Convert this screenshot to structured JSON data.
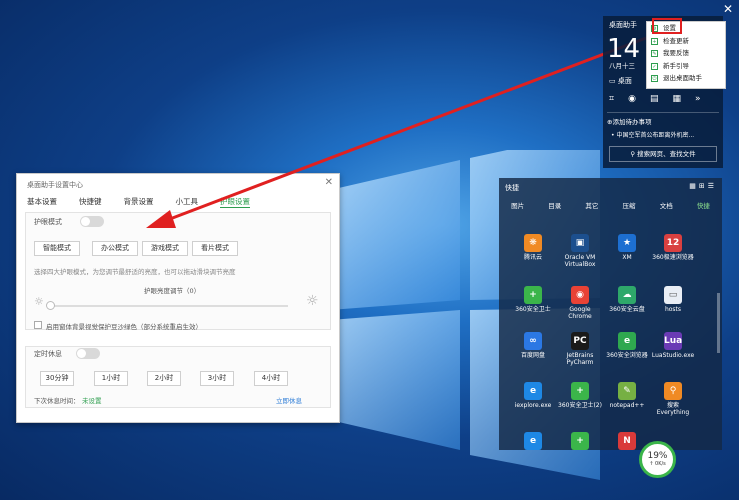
{
  "desktop": {
    "close_symbol": "✕"
  },
  "dialog": {
    "title": "桌面助手设置中心",
    "close_symbol": "✕",
    "tabs": [
      {
        "label": "基本设置"
      },
      {
        "label": "快捷键"
      },
      {
        "label": "背景设置"
      },
      {
        "label": "小工具"
      },
      {
        "label": "护眼设置"
      }
    ],
    "eye_mode_label": "护眼模式",
    "modes": [
      {
        "label": "智能模式"
      },
      {
        "label": "办公模式"
      },
      {
        "label": "游戏模式"
      },
      {
        "label": "看片模式"
      }
    ],
    "mode_hint": "选择四大护眼模式，为您调节最舒适的亮度，也可以拖动滑块调节亮度",
    "brightness_label": "护眼亮度调节（0）",
    "brightness_value": 0,
    "checkbox_label": "启用窗体背景视觉保护豆沙绿色（部分系统重启生效）",
    "rest_label": "定时休息",
    "rest_options": [
      {
        "label": "30分钟"
      },
      {
        "label": "1小时"
      },
      {
        "label": "2小时"
      },
      {
        "label": "3小时"
      },
      {
        "label": "4小时"
      }
    ],
    "next_rest_label": "下次休息时间：",
    "next_rest_value": "未设置",
    "rest_now": "立即休息"
  },
  "widget": {
    "title": "桌面助手",
    "big_digits": "14",
    "date": "八月十三",
    "desktop_label": "桌面",
    "todo": "⊕添加待办事项",
    "news": "• 中国空军首公布距离外机密...",
    "search": "搜索网页、查找文件"
  },
  "menu": {
    "items": [
      {
        "label": "设置"
      },
      {
        "label": "检查更新"
      },
      {
        "label": "我要反馈"
      },
      {
        "label": "新手引导"
      },
      {
        "label": "退出桌面助手"
      }
    ]
  },
  "box": {
    "title": "快捷",
    "tabs": [
      {
        "label": "图片"
      },
      {
        "label": "目录"
      },
      {
        "label": "其它"
      },
      {
        "label": "压缩"
      },
      {
        "label": "文档"
      },
      {
        "label": "快捷"
      }
    ],
    "icons": [
      {
        "label": "腾讯云",
        "glyph": "❋",
        "color": "#f08a24"
      },
      {
        "label": "Oracle VM VirtualBox",
        "glyph": "▣",
        "color": "#1c4f8e"
      },
      {
        "label": "XM",
        "glyph": "★",
        "color": "#1d6fd1"
      },
      {
        "label": "360极速浏览器",
        "glyph": "12",
        "color": "#d94040"
      },
      {
        "label": "360安全卫士",
        "glyph": "+",
        "color": "#3bb54a"
      },
      {
        "label": "Google Chrome",
        "glyph": "◉",
        "color": "#e94235"
      },
      {
        "label": "360安全云盘",
        "glyph": "☁",
        "color": "#2ea86a"
      },
      {
        "label": "hosts",
        "glyph": "▭",
        "color": "#e9eef5"
      },
      {
        "label": "百度网盘",
        "glyph": "∞",
        "color": "#2b78e4"
      },
      {
        "label": "JetBrains PyCharm",
        "glyph": "PC",
        "color": "#1a1a1a"
      },
      {
        "label": "360安全浏览器",
        "glyph": "e",
        "color": "#2fa84f"
      },
      {
        "label": "LuaStudio.exe",
        "glyph": "Lua",
        "color": "#6a3bb5"
      },
      {
        "label": "iexplore.exe",
        "glyph": "e",
        "color": "#1e88e5"
      },
      {
        "label": "360安全卫士(2)",
        "glyph": "+",
        "color": "#3bb54a"
      },
      {
        "label": "notepad++",
        "glyph": "✎",
        "color": "#76b043"
      },
      {
        "label": "搜索Everything",
        "glyph": "⚲",
        "color": "#f08a24"
      },
      {
        "label": "",
        "glyph": "e",
        "color": "#1e88e5"
      },
      {
        "label": "",
        "glyph": "+",
        "color": "#3bb54a"
      },
      {
        "label": "",
        "glyph": "N",
        "color": "#d93a3a"
      }
    ]
  },
  "speed_ball": {
    "percent": "19%",
    "speed": "↑ 0K/s"
  }
}
